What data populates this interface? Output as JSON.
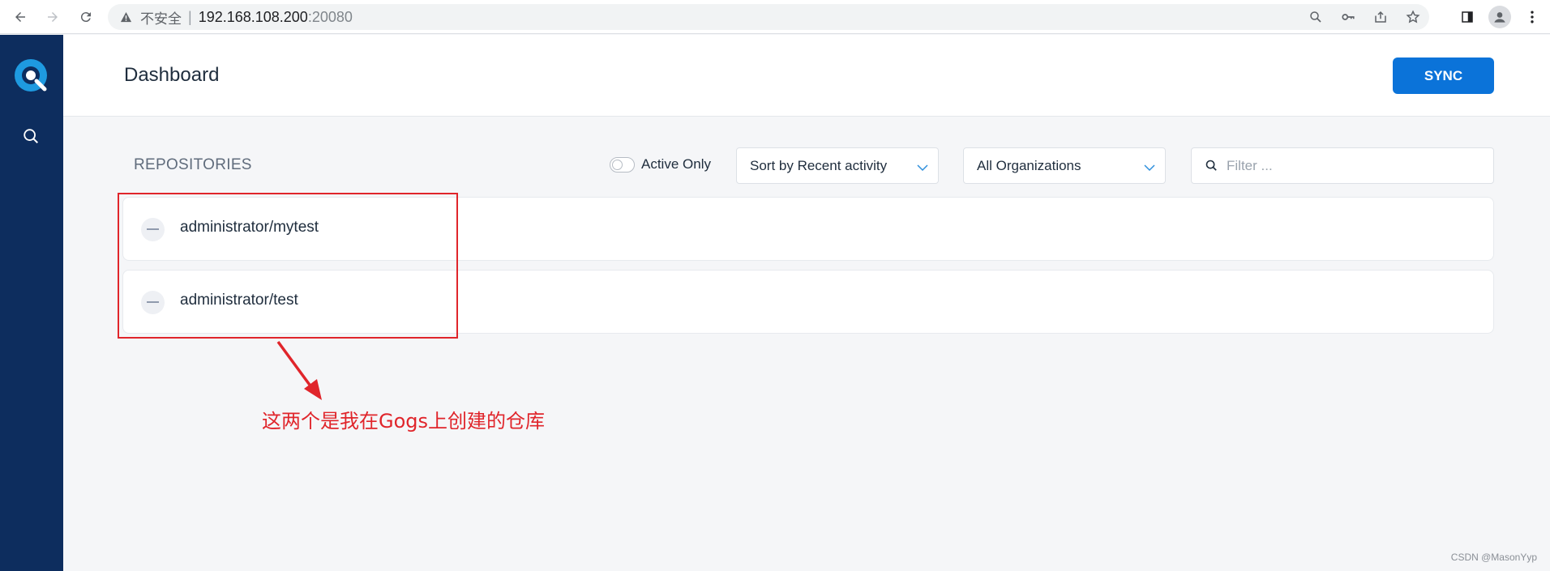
{
  "browser": {
    "security_label": "不安全",
    "separator": "|",
    "host": "192.168.108.200",
    "port": ":20080"
  },
  "header": {
    "title": "Dashboard",
    "sync_label": "SYNC"
  },
  "repositories": {
    "section_title": "REPOSITORIES",
    "active_only_label": "Active Only",
    "active_only": false,
    "sort_value": "Sort by Recent activity",
    "org_value": "All Organizations",
    "filter_placeholder": "Filter ...",
    "items": [
      {
        "name": "administrator/mytest"
      },
      {
        "name": "administrator/test"
      }
    ]
  },
  "annotation": {
    "text": "这两个是我在Gogs上创建的仓库"
  },
  "watermark": "CSDN @MasonYyp",
  "colors": {
    "sidebar": "#0d2d5e",
    "accent": "#0b73d9",
    "annotation": "#e0252b"
  }
}
